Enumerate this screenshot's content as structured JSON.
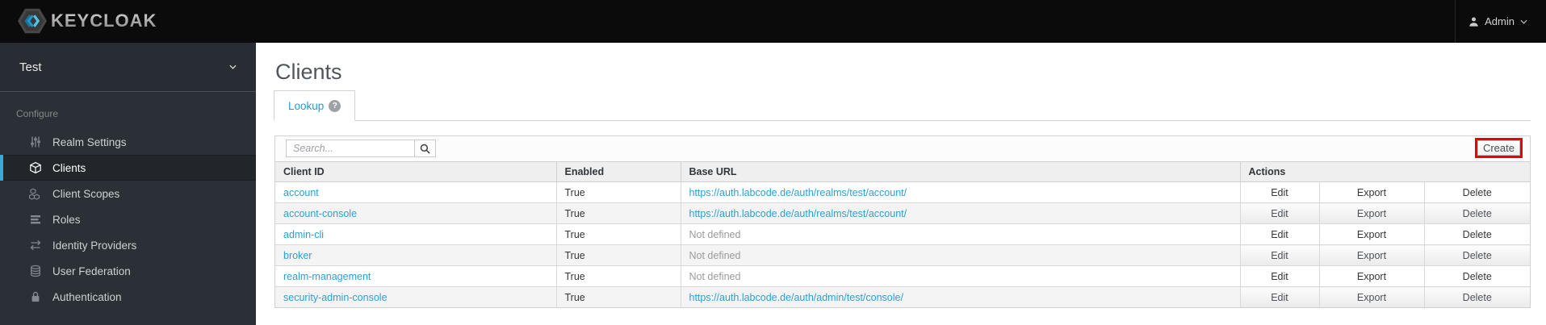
{
  "header": {
    "brand": "KEYCLOAK",
    "user": {
      "name": "Admin"
    }
  },
  "sidebar": {
    "realm": {
      "name": "Test"
    },
    "section_label": "Configure",
    "items": [
      {
        "label": "Realm Settings",
        "icon": "sliders-icon",
        "active": false
      },
      {
        "label": "Clients",
        "icon": "cube-icon",
        "active": true
      },
      {
        "label": "Client Scopes",
        "icon": "cubes-icon",
        "active": false
      },
      {
        "label": "Roles",
        "icon": "list-icon",
        "active": false
      },
      {
        "label": "Identity Providers",
        "icon": "exchange-icon",
        "active": false
      },
      {
        "label": "User Federation",
        "icon": "database-icon",
        "active": false
      },
      {
        "label": "Authentication",
        "icon": "lock-icon",
        "active": false
      }
    ]
  },
  "main": {
    "title": "Clients",
    "tab": {
      "label": "Lookup",
      "help_symbol": "?"
    },
    "toolbar": {
      "search_placeholder": "Search...",
      "create_label": "Create"
    },
    "table": {
      "columns": [
        "Client ID",
        "Enabled",
        "Base URL",
        "Actions"
      ],
      "actions": [
        "Edit",
        "Export",
        "Delete"
      ],
      "rows": [
        {
          "client_id": "account",
          "enabled": "True",
          "base_url": "https://auth.labcode.de/auth/realms/test/account/",
          "base_url_defined": true
        },
        {
          "client_id": "account-console",
          "enabled": "True",
          "base_url": "https://auth.labcode.de/auth/realms/test/account/",
          "base_url_defined": true
        },
        {
          "client_id": "admin-cli",
          "enabled": "True",
          "base_url": "Not defined",
          "base_url_defined": false
        },
        {
          "client_id": "broker",
          "enabled": "True",
          "base_url": "Not defined",
          "base_url_defined": false
        },
        {
          "client_id": "realm-management",
          "enabled": "True",
          "base_url": "Not defined",
          "base_url_defined": false
        },
        {
          "client_id": "security-admin-console",
          "enabled": "True",
          "base_url": "https://auth.labcode.de/auth/admin/test/console/",
          "base_url_defined": true
        }
      ]
    }
  },
  "colors": {
    "header_bg": "#0b0b0b",
    "sidebar_bg": "#2b3036",
    "accent_blue": "#39a9dc",
    "link_blue": "#2d9fd6",
    "annotation_red": "#ee0000"
  }
}
